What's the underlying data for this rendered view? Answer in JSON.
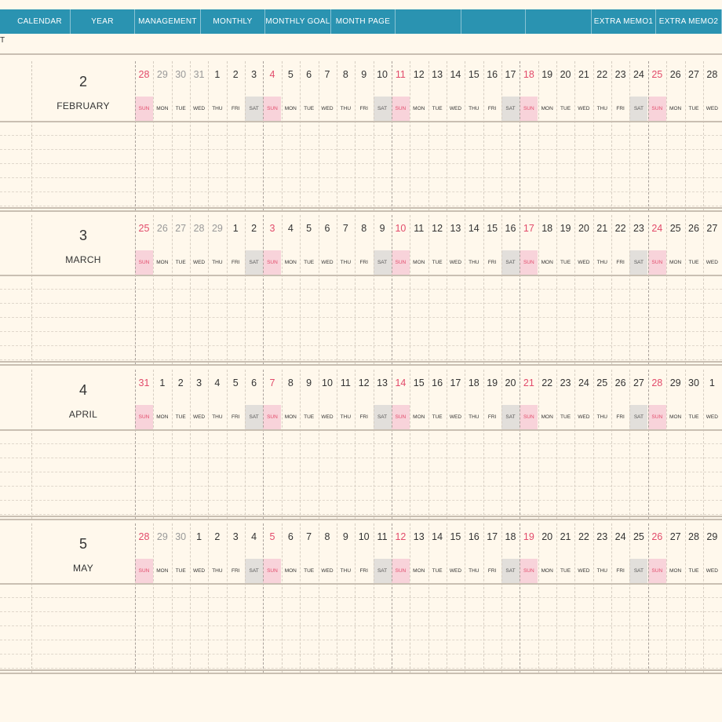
{
  "nav": {
    "tabs": [
      "CALENDAR",
      "YEAR",
      "MANAGEMENT",
      "MONTHLY",
      "MONTHLY GOAL",
      "MONTH PAGE",
      "",
      "",
      "",
      "EXTRA MEMO1",
      "EXTRA MEMO2"
    ]
  },
  "corner_text": "T",
  "colors": {
    "nav_bg": "#2A93B1",
    "sunday": "#E24B6B",
    "sunday_bg": "#F8D3DA",
    "saturday_bg": "#E2DFDB",
    "page_bg": "#FFF8EC"
  },
  "dow_labels": [
    "SUN",
    "MON",
    "TUE",
    "WED",
    "THU",
    "FRI",
    "SAT"
  ],
  "months": [
    {
      "number": "2",
      "name": "FEBRUARY",
      "days": [
        "28",
        "29",
        "30",
        "31",
        "1",
        "2",
        "3",
        "4",
        "5",
        "6",
        "7",
        "8",
        "9",
        "10",
        "11",
        "12",
        "13",
        "14",
        "15",
        "16",
        "17",
        "18",
        "19",
        "20",
        "21",
        "22",
        "23",
        "24",
        "25",
        "26",
        "27",
        "28"
      ],
      "prev_count": 4
    },
    {
      "number": "3",
      "name": "MARCH",
      "days": [
        "25",
        "26",
        "27",
        "28",
        "29",
        "1",
        "2",
        "3",
        "4",
        "5",
        "6",
        "7",
        "8",
        "9",
        "10",
        "11",
        "12",
        "13",
        "14",
        "15",
        "16",
        "17",
        "18",
        "19",
        "20",
        "21",
        "22",
        "23",
        "24",
        "25",
        "26",
        "27"
      ],
      "prev_count": 5
    },
    {
      "number": "4",
      "name": "APRIL",
      "days": [
        "31",
        "1",
        "2",
        "3",
        "4",
        "5",
        "6",
        "7",
        "8",
        "9",
        "10",
        "11",
        "12",
        "13",
        "14",
        "15",
        "16",
        "17",
        "18",
        "19",
        "20",
        "21",
        "22",
        "23",
        "24",
        "25",
        "26",
        "27",
        "28",
        "29",
        "30",
        "1"
      ],
      "prev_count": 1
    },
    {
      "number": "5",
      "name": "MAY",
      "days": [
        "28",
        "29",
        "30",
        "1",
        "2",
        "3",
        "4",
        "5",
        "6",
        "7",
        "8",
        "9",
        "10",
        "11",
        "12",
        "13",
        "14",
        "15",
        "16",
        "17",
        "18",
        "19",
        "20",
        "21",
        "22",
        "23",
        "24",
        "25",
        "26",
        "27",
        "28",
        "29"
      ],
      "prev_count": 3
    }
  ]
}
